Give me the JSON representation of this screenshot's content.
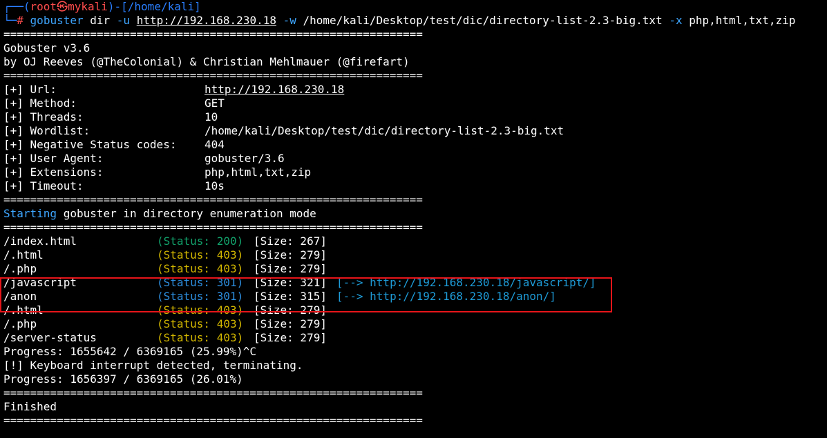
{
  "prompt": {
    "line1_prefix": "┌──(",
    "user": "root",
    "at": "㉿",
    "host": "mykali",
    "line1_mid": ")-[",
    "path": "/home/kali",
    "line1_end": "]",
    "line2_prefix": "└─",
    "hash": "#",
    "cmd": "gobuster",
    "subcmd": " dir ",
    "flag_u": "-u",
    "url": "http://192.168.230.18",
    "flag_w": "-w",
    "wordlist": " /home/kali/Desktop/test/dic/directory-list-2.3-big.txt ",
    "flag_x": "-x",
    "extensions": " php,html,txt,zip"
  },
  "separator": "===============================================================",
  "banner": {
    "version": "Gobuster v3.6",
    "authors": "by OJ Reeves (@TheColonial) & Christian Mehlmauer (@firefart)"
  },
  "config": [
    {
      "key": "[+] Url:",
      "value": "http://192.168.230.18",
      "link": true
    },
    {
      "key": "[+] Method:",
      "value": "GET"
    },
    {
      "key": "[+] Threads:",
      "value": "10"
    },
    {
      "key": "[+] Wordlist:",
      "value": "/home/kali/Desktop/test/dic/directory-list-2.3-big.txt"
    },
    {
      "key": "[+] Negative Status codes:",
      "value": "404"
    },
    {
      "key": "[+] User Agent:",
      "value": "gobuster/3.6"
    },
    {
      "key": "[+] Extensions:",
      "value": "php,html,txt,zip"
    },
    {
      "key": "[+] Timeout:",
      "value": "10s"
    }
  ],
  "starting": {
    "word": "Starting",
    "rest": " gobuster in directory enumeration mode"
  },
  "results": [
    {
      "path": "/index.html",
      "status": "(Status: 200)",
      "color": "green",
      "size": "[Size: 267]",
      "redirect": ""
    },
    {
      "path": "/.html",
      "status": "(Status: 403)",
      "color": "yellow",
      "size": "[Size: 279]",
      "redirect": ""
    },
    {
      "path": "/.php",
      "status": "(Status: 403)",
      "color": "yellow",
      "size": "[Size: 279]",
      "redirect": ""
    },
    {
      "path": "/javascript",
      "status": "(Status: 301)",
      "color": "blue",
      "size": "[Size: 321]",
      "redirect": "[--> http://192.168.230.18/javascript/]"
    },
    {
      "path": "/anon",
      "status": "(Status: 301)",
      "color": "blue",
      "size": "[Size: 315]",
      "redirect": "[--> http://192.168.230.18/anon/]"
    },
    {
      "path": "/.html",
      "status": "(Status: 403)",
      "color": "yellow",
      "size": "[Size: 279]",
      "redirect": ""
    },
    {
      "path": "/.php",
      "status": "(Status: 403)",
      "color": "yellow",
      "size": "[Size: 279]",
      "redirect": ""
    },
    {
      "path": "/server-status",
      "status": "(Status: 403)",
      "color": "yellow",
      "size": "[Size: 279]",
      "redirect": ""
    }
  ],
  "footer": {
    "progress1": "Progress: 1655642 / 6369165 (25.99%)^C",
    "interrupt": "[!] Keyboard interrupt detected, terminating.",
    "progress2": "Progress: 1656397 / 6369165 (26.01%)",
    "finished": "Finished"
  }
}
